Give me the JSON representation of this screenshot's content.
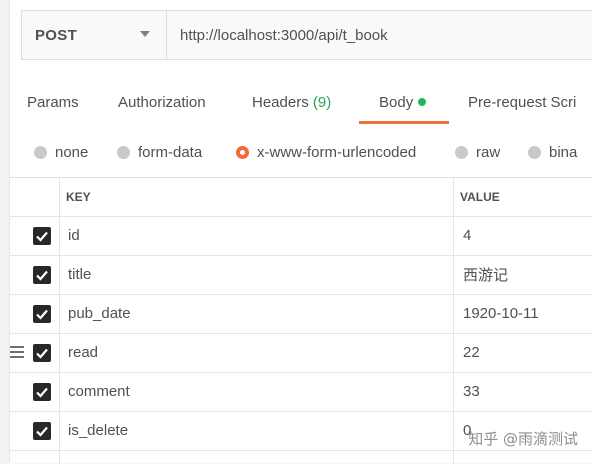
{
  "request": {
    "method": "POST",
    "url": "http://localhost:3000/api/t_book"
  },
  "tabs": [
    {
      "label": "Params"
    },
    {
      "label": "Authorization"
    },
    {
      "label": "Headers",
      "count": "(9)"
    },
    {
      "label": "Body",
      "active": true
    },
    {
      "label": "Pre-request Scri"
    }
  ],
  "body_types": [
    {
      "label": "none"
    },
    {
      "label": "form-data"
    },
    {
      "label": "x-www-form-urlencoded",
      "selected": true
    },
    {
      "label": "raw"
    },
    {
      "label": "bina"
    }
  ],
  "table": {
    "headers": {
      "key": "KEY",
      "value": "VALUE"
    },
    "rows": [
      {
        "key": "id",
        "value": "4",
        "checked": true
      },
      {
        "key": "title",
        "value": "西游记",
        "checked": true
      },
      {
        "key": "pub_date",
        "value": "1920-10-11",
        "checked": true
      },
      {
        "key": "read",
        "value": "22",
        "checked": true
      },
      {
        "key": "comment",
        "value": "33",
        "checked": true
      },
      {
        "key": "is_delete",
        "value": "0",
        "checked": true
      }
    ]
  },
  "colors": {
    "accent": "#f26b3a",
    "status_green": "#26b55c"
  },
  "watermark": "知乎 @雨滴测试"
}
